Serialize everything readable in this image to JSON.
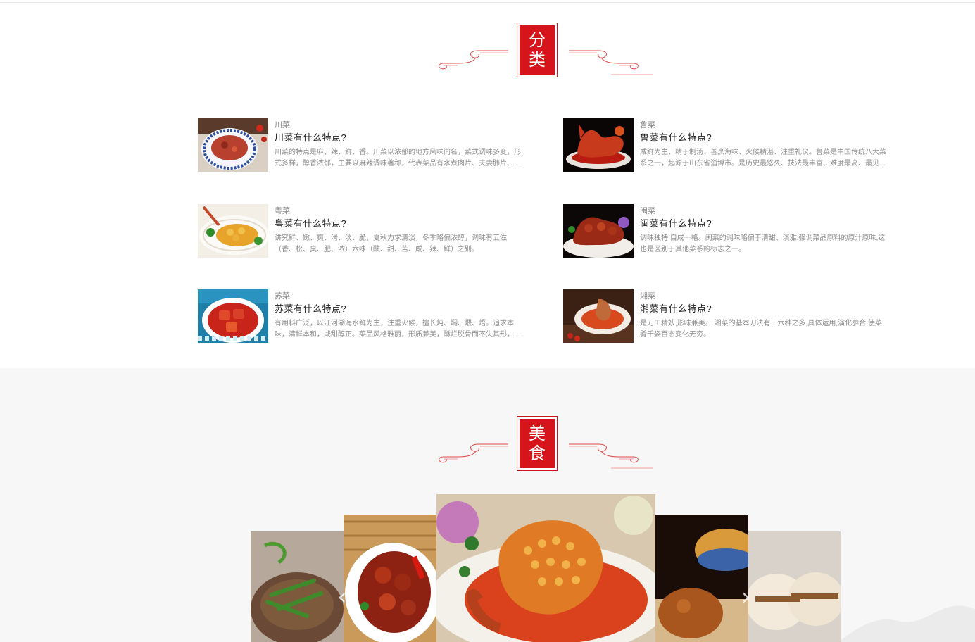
{
  "categories_section": {
    "seal_text": "分类",
    "items": [
      {
        "tag": "川菜",
        "title": "川菜有什么特点?",
        "desc": "川菜的特点是麻、辣、鲜、香。川菜以浓郁的地方风味闻名，菜式调味多变，形式多样，醇香浓郁，主要以麻辣调味著称，代表菜品有水煮肉片、夫妻肺片、..."
      },
      {
        "tag": "鲁菜",
        "title": "鲁菜有什么特点?",
        "desc": "咸鲜为主、精于制汤、善烹海味、火候精湛、注重礼仪。鲁菜是中国传统八大菜系之一，起源于山东省淄博市。是历史最悠久、技法最丰富、难度最高、最见..."
      },
      {
        "tag": "粤菜",
        "title": "粤菜有什么特点?",
        "desc": "讲究鲜、嫩、爽、滑、淡、脆，夏秋力求清淡，冬季略偏浓醇，调味有五滋（香、松、臭、肥、浓）六味（酸、甜、苦、咸、辣、鲜）之别。"
      },
      {
        "tag": "闽菜",
        "title": "闽菜有什么特点?",
        "desc": "调味独特,自成一格。闽菜的调味略偏于清甜、淡雅,强调菜品原料的原汁原味,这也是区别于其他菜系的标志之一。"
      },
      {
        "tag": "苏菜",
        "title": "苏菜有什么特点?",
        "desc": "有用料广泛，以江河湖海水鲜为主，注重火候，擅长炖、焖、煨、焐。追求本味，清鲜本和，咸甜醇正。菜品风格雅丽，形质兼美，酥烂脱骨而不失其形，..."
      },
      {
        "tag": "湘菜",
        "title": "湘菜有什么特点?",
        "desc": "是刀工精妙,形味兼美。 湘菜的基本刀法有十六种之多,具体运用,演化参合,使菜肴千姿百态变化无穷。"
      }
    ]
  },
  "food_section": {
    "seal_text": "美食",
    "prev_label": "‹",
    "next_label": "›"
  },
  "colors": {
    "accent": "#d6141c"
  }
}
